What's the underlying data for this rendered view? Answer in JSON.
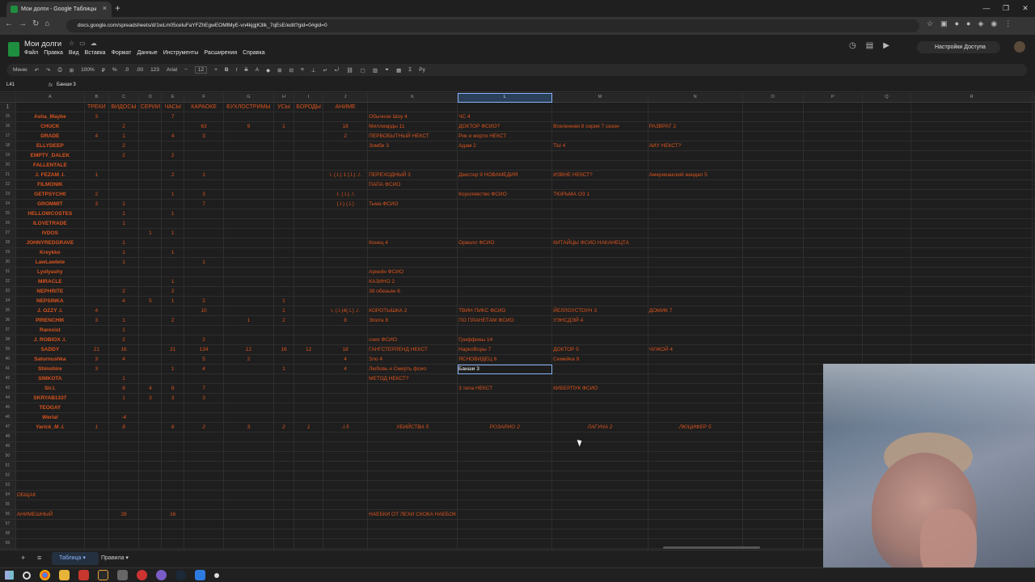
{
  "browser": {
    "tab_title": "Мои долги - Google Таблицы",
    "url": "docs.google.com/spreadsheets/d/1wLm05celuFaYFZhEgwEOMlMyE-vn4kjgjK3lk_7qEsE/edit?gid=0#gid=0"
  },
  "app": {
    "title": "Мои долги",
    "menu": [
      "Файл",
      "Правка",
      "Вид",
      "Вставка",
      "Формат",
      "Данные",
      "Инструменты",
      "Расширения",
      "Справка"
    ],
    "share_label": "Настройки Доступа"
  },
  "toolbar": {
    "menu_label": "Меню",
    "zoom": "100%",
    "currency": "₽",
    "percent": "%",
    "dec_minus": ".0",
    "dec_plus": ".00",
    "format123": "123",
    "font": "Arial",
    "font_size": "12"
  },
  "formula": {
    "cell": "L41",
    "fx": "fx",
    "value": "Банши 3"
  },
  "columns": [
    "A",
    "B",
    "C",
    "D",
    "E",
    "F",
    "G",
    "H",
    "I",
    "J",
    "K",
    "L",
    "M",
    "N",
    "O",
    "P",
    "Q",
    "R"
  ],
  "header_row": {
    "num": "1",
    "cells": [
      "",
      "ТРЕКИ",
      "ВИДОСЫ",
      "СЕРИИ",
      "ЧАСЫ",
      "КАРАОКЕ",
      "БУХЛОСТРИМЫ",
      "УСЫ",
      "БОРОДЫ",
      "АНИМЕ",
      "",
      "",
      "",
      "",
      "",
      "",
      "",
      ""
    ]
  },
  "rows": [
    {
      "num": "15",
      "cells": [
        "Asha_Maybe",
        "3",
        "",
        "",
        "7",
        "",
        "",
        "",
        "",
        "",
        "Обычное Шоу 4",
        "ЧС 4",
        "",
        "",
        "",
        "",
        "",
        ""
      ]
    },
    {
      "num": "16",
      "cells": [
        "CHUCK",
        "",
        "2",
        "",
        "",
        "63",
        "9",
        "1",
        "",
        "18",
        "Миллиарды 11",
        "ДОКТОР ФСИО?",
        "Вселенная 8 серия 7 сезон",
        "РАЗВРАТ 2",
        "",
        "",
        "",
        ""
      ]
    },
    {
      "num": "17",
      "cells": [
        "DRADE",
        "4",
        "1",
        "",
        "4",
        "3",
        "",
        "",
        "",
        "2",
        "ПЕРВОБЫТНЫЙ НЕКСТ",
        "Рик и морти НЕКСТ",
        "",
        "",
        "",
        "",
        "",
        ""
      ]
    },
    {
      "num": "18",
      "cells": [
        "ELLYDEEP",
        "",
        "2",
        "",
        "",
        "",
        "",
        "",
        "",
        "",
        "Зомби 3",
        "Адам 2",
        "ТЫ 4",
        "АИУ НЕКСТ?",
        "",
        "",
        "",
        ""
      ]
    },
    {
      "num": "19",
      "cells": [
        "EMPTY_DALEK",
        "",
        "2",
        "",
        "2",
        "",
        "",
        "",
        "",
        "",
        "",
        "",
        "",
        "",
        "",
        "",
        "",
        ""
      ]
    },
    {
      "num": "20",
      "cells": [
        "FALLENTALE",
        "",
        "",
        "",
        "",
        "",
        "",
        "",
        "",
        "",
        "",
        "",
        "",
        "",
        "",
        "",
        "",
        ""
      ]
    },
    {
      "num": "21",
      "cells": [
        "J. FEZAM .I.",
        "1",
        "",
        "",
        "2",
        "1",
        "",
        "",
        "",
        "\\. (.I.) 1 (.I.) ./.",
        "ПЕРЕХОДНЫЙ 3",
        "Декстер 9 НОВАМЕДИЯ",
        "ИЗВНЕ НЕКСТ?",
        "Американский вандал 5",
        "",
        "",
        "",
        ""
      ]
    },
    {
      "num": "22",
      "cells": [
        "FILMONIK",
        "",
        "",
        "",
        "",
        "",
        "",
        "",
        "",
        "",
        "ПАПА ФСИО",
        "",
        "",
        "",
        "",
        "",
        "",
        ""
      ]
    },
    {
      "num": "23",
      "cells": [
        "GETPSYCH0",
        "2",
        "",
        "",
        "1",
        "3",
        "",
        "",
        "",
        ".I. (.I.) .\\.",
        "",
        "Королевство ФСИО",
        "ТЮРЬМА ОЗ 1",
        "",
        "",
        "",
        "",
        ""
      ]
    },
    {
      "num": "24",
      "cells": [
        "GROMMIT",
        "3",
        "1",
        "",
        "",
        "7",
        "",
        "",
        "",
        "(.I.) (.I.)",
        "Тьма ФСИО",
        "",
        "",
        "",
        "",
        "",
        "",
        ""
      ]
    },
    {
      "num": "25",
      "cells": [
        "HELLOWCOSTES",
        "",
        "1",
        "",
        "1",
        "",
        "",
        "",
        "",
        "",
        "",
        "",
        "",
        "",
        "",
        "",
        "",
        ""
      ]
    },
    {
      "num": "26",
      "cells": [
        "ILOVETRADE",
        "",
        "1",
        "",
        "",
        "",
        "",
        "",
        "",
        "",
        "",
        "",
        "",
        "",
        "",
        "",
        "",
        ""
      ]
    },
    {
      "num": "27",
      "cells": [
        "IVDOS",
        "",
        "",
        "1",
        "1",
        "",
        "",
        "",
        "",
        "",
        "",
        "",
        "",
        "",
        "",
        "",
        "",
        ""
      ]
    },
    {
      "num": "28",
      "cells": [
        "JOHNYREDGRAVE",
        "",
        "1",
        "",
        "",
        "",
        "",
        "",
        "",
        "",
        "Конец 4",
        "Орвилл ФСИО",
        "КИТАЙЦЫ ФСИО НАКАНЕЦТА",
        "",
        "",
        "",
        "",
        ""
      ]
    },
    {
      "num": "29",
      "cells": [
        "Kreykko",
        "",
        "1",
        "",
        "1",
        "",
        "",
        "",
        "",
        "",
        "",
        "",
        "",
        "",
        "",
        "",
        "",
        ""
      ]
    },
    {
      "num": "30",
      "cells": [
        "LawLawlete",
        "",
        "1",
        "",
        "",
        "1",
        "",
        "",
        "",
        "",
        "",
        "",
        "",
        "",
        "",
        "",
        "",
        ""
      ]
    },
    {
      "num": "31",
      "cells": [
        "Lyolyashy",
        "",
        "",
        "",
        "",
        "",
        "",
        "",
        "",
        "",
        "Аркейн ФСИО",
        "",
        "",
        "",
        "",
        "",
        "",
        ""
      ]
    },
    {
      "num": "32",
      "cells": [
        "MIRACLE",
        "",
        "",
        "",
        "1",
        "",
        "",
        "",
        "",
        "",
        "КАЗИНО 2",
        "",
        "",
        "",
        "",
        "",
        "",
        ""
      ]
    },
    {
      "num": "33",
      "cells": [
        "NEPHRITE",
        "",
        "2",
        "",
        "2",
        "",
        "",
        "",
        "",
        "",
        "38 обезьян 6",
        "",
        "",
        "",
        "",
        "",
        "",
        ""
      ]
    },
    {
      "num": "34",
      "cells": [
        "NEPSINKA",
        "",
        "4",
        "5",
        "1",
        "2",
        "",
        "1",
        "",
        "",
        "",
        "",
        "",
        "",
        "",
        "",
        "",
        ""
      ]
    },
    {
      "num": "35",
      "cells": [
        "J. OZZY .I.",
        "4",
        "",
        "",
        "",
        "10",
        "",
        "1",
        "",
        "\\. (.I.)4(.I.) ./.",
        "КОРОТЫШКА 2",
        "ТВИН ПИКС ФСИО",
        "ЙЕЛЛОУСТОУН 3",
        "ДОМИК 7",
        "",
        "",
        "",
        ""
      ]
    },
    {
      "num": "36",
      "cells": [
        "PIRENCHIK",
        "3",
        "1",
        "",
        "2",
        "",
        "1",
        "2",
        "",
        "8",
        "Элита 8",
        "ПО ПЛАНЕТАМ ФСИО",
        "УЭНСДЭЙ 4",
        "",
        "",
        "",
        "",
        ""
      ]
    },
    {
      "num": "37",
      "cells": [
        "Rarexist",
        "",
        "1",
        "",
        "",
        "",
        "",
        "",
        "",
        "",
        "",
        "",
        "",
        "",
        "",
        "",
        "",
        ""
      ]
    },
    {
      "num": "38",
      "cells": [
        "J. ROBIOX .I.",
        "",
        "2",
        "",
        "",
        "2",
        "",
        "",
        "",
        "",
        "снех ФСИО",
        "Гриффины 14",
        "",
        "",
        "",
        "",
        "",
        ""
      ]
    },
    {
      "num": "39",
      "cells": [
        "SADDY",
        "21",
        "16",
        "",
        "21",
        "134",
        "12",
        "16",
        "12",
        "18",
        "ГАНГСТЕРЛЕНД НЕКСТ",
        "НаркоВоры 7",
        "ДОКТОР 5",
        "ЧУЖОЙ 4",
        "",
        "",
        "",
        ""
      ]
    },
    {
      "num": "40",
      "cells": [
        "Saturnushka",
        "3",
        "4",
        "",
        "",
        "5",
        "2",
        "",
        "",
        "4",
        "Зло 4",
        "ЯСНОВИДЕЦ 6",
        "Семейка 9",
        "",
        "",
        "",
        "",
        ""
      ]
    },
    {
      "num": "41",
      "cells": [
        "Shinshire",
        "3",
        "",
        "",
        "1",
        "4",
        "",
        "1",
        "",
        "4",
        "Любовь и Смерть фсио",
        "Банши 3",
        "",
        "",
        "",
        "",
        "",
        ""
      ]
    },
    {
      "num": "42",
      "cells": [
        "SIMKOTA",
        "",
        "1",
        "",
        "",
        "",
        "",
        "",
        "",
        "",
        "МЕТОД НЕКСТ?",
        "",
        "",
        "",
        "",
        "",
        "",
        ""
      ]
    },
    {
      "num": "43",
      "cells": [
        "Sir.I.",
        "",
        "8",
        "4",
        "8",
        "7",
        "",
        "",
        "",
        "",
        "",
        "3 тела НЕКСТ",
        "КИБЕРПУК ФСИО",
        "",
        "",
        "",
        "",
        ""
      ]
    },
    {
      "num": "44",
      "cells": [
        "SKRYAB1337",
        "",
        "1",
        "3",
        "3",
        "3",
        "",
        "",
        "",
        "",
        "",
        "",
        "",
        "",
        "",
        "",
        "",
        ""
      ]
    },
    {
      "num": "45",
      "cells": [
        "TEOGAY",
        "",
        "",
        "",
        "",
        "",
        "",
        "",
        "",
        "",
        "",
        "",
        "",
        "",
        "",
        "",
        "",
        ""
      ]
    },
    {
      "num": "46",
      "cells": [
        "Werial",
        "",
        "-4",
        "",
        "",
        "",
        "",
        "",
        "",
        "",
        "",
        "",
        "",
        "",
        "",
        "",
        "",
        ""
      ]
    },
    {
      "num": "47",
      "cells": [
        "Yarick_M .I.",
        "1",
        "8",
        "",
        "6",
        "2",
        "3",
        "2",
        "1",
        ".I.5",
        "УБИЙСТВА 5",
        "РОЗАРИО 2",
        "ЛАГУНА 2",
        "ЛЮЦИФЕР 5",
        "",
        "",
        "",
        ""
      ]
    },
    {
      "num": "48",
      "cells": [
        "",
        "",
        "",
        "",
        "",
        "",
        "",
        "",
        "",
        "",
        "",
        "",
        "",
        "",
        "",
        "",
        "",
        ""
      ]
    },
    {
      "num": "49",
      "cells": [
        "",
        "",
        "",
        "",
        "",
        "",
        "",
        "",
        "",
        "",
        "",
        "",
        "",
        "",
        "",
        "",
        "",
        ""
      ]
    },
    {
      "num": "50",
      "cells": [
        "",
        "",
        "",
        "",
        "",
        "",
        "",
        "",
        "",
        "",
        "",
        "",
        "",
        "",
        "",
        "",
        "",
        ""
      ]
    },
    {
      "num": "51",
      "cells": [
        "",
        "",
        "",
        "",
        "",
        "",
        "",
        "",
        "",
        "",
        "",
        "",
        "",
        "",
        "",
        "",
        "",
        ""
      ]
    },
    {
      "num": "52",
      "cells": [
        "",
        "",
        "",
        "",
        "",
        "",
        "",
        "",
        "",
        "",
        "",
        "",
        "",
        "",
        "",
        "",
        "",
        ""
      ]
    },
    {
      "num": "53",
      "cells": [
        "",
        "",
        "",
        "",
        "",
        "",
        "",
        "",
        "",
        "",
        "",
        "",
        "",
        "",
        "",
        "",
        "",
        ""
      ]
    },
    {
      "num": "54",
      "cells": [
        "ОБЩАК",
        "",
        "",
        "",
        "",
        "",
        "",
        "",
        "",
        "",
        "",
        "",
        "",
        "",
        "",
        "",
        "",
        ""
      ]
    },
    {
      "num": "55",
      "cells": [
        "",
        "",
        "",
        "",
        "",
        "",
        "",
        "",
        "",
        "",
        "",
        "",
        "",
        "",
        "",
        "",
        "",
        ""
      ]
    },
    {
      "num": "56",
      "cells": [
        "АНИМЕШНЫЙ",
        "",
        "28",
        "",
        "16",
        "",
        "",
        "",
        "",
        "",
        "НАЕБКИ ОТ ЛЕХИ СКОКА НАЕБОК",
        "",
        "",
        "",
        "",
        "",
        "",
        ""
      ]
    },
    {
      "num": "57",
      "cells": [
        "",
        "",
        "",
        "",
        "",
        "",
        "",
        "",
        "",
        "",
        "",
        "",
        "",
        "",
        "",
        "",
        "",
        ""
      ]
    },
    {
      "num": "58",
      "cells": [
        "",
        "",
        "",
        "",
        "",
        "",
        "",
        "",
        "",
        "",
        "",
        "",
        "",
        "",
        "",
        "",
        "",
        ""
      ]
    },
    {
      "num": "59",
      "cells": [
        "",
        "",
        "",
        "",
        "",
        "",
        "",
        "",
        "",
        "",
        "",
        "",
        "",
        "",
        "",
        "",
        "",
        ""
      ]
    },
    {
      "num": "60",
      "cells": [
        "",
        "",
        "",
        "",
        "",
        "",
        "",
        "",
        "",
        "",
        "",
        "",
        "",
        "",
        "",
        "",
        "",
        ""
      ]
    },
    {
      "num": "61",
      "cells": [
        "",
        "",
        "",
        "",
        "",
        "",
        "",
        "",
        "",
        "",
        "",
        "",
        "",
        "",
        "",
        "",
        "",
        ""
      ]
    }
  ],
  "sheets": [
    "Таблица",
    "Правила"
  ],
  "colors": {
    "text_accent": "#d9541e",
    "selection": "#8ab4f8",
    "sheets_green": "#1e8e3e"
  }
}
